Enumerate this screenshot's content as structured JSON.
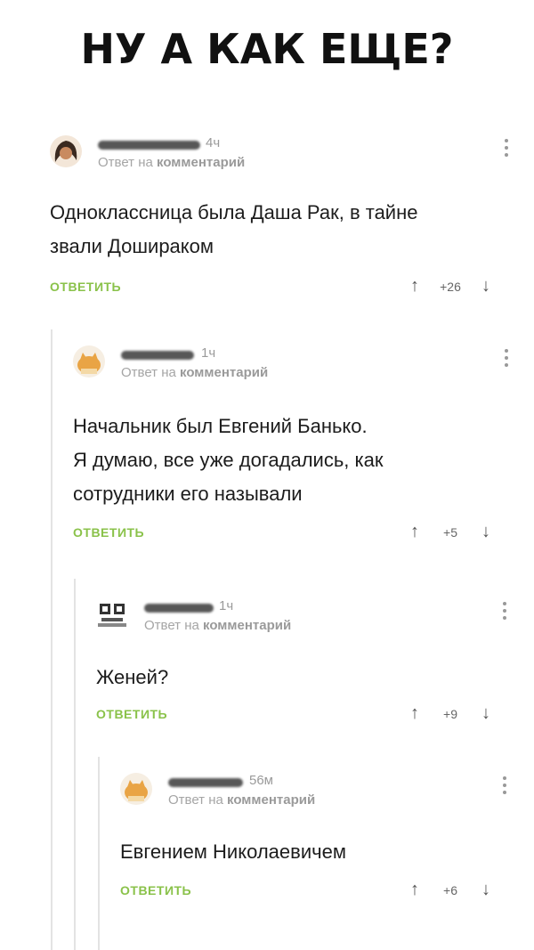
{
  "meme_title": "НУ А КАК ЕЩЕ?",
  "reply_label_prefix": "Ответ на",
  "reply_label_target": "комментарий",
  "reply_button": "ОТВЕТИТЬ",
  "upvote_icon": "↑",
  "downvote_icon": "↓",
  "accent_color": "#8ac24a",
  "comments": [
    {
      "time": "4ч",
      "avatar": "woman-avatar",
      "text_lines": [
        "Одноклассница была Даша Рак, в тайне",
        "звали Дошираком"
      ],
      "score": "+26"
    },
    {
      "time": "1ч",
      "avatar": "cat-avatar",
      "text_lines": [
        "Начальник был Евгений Банько.",
        "Я думаю, все уже догадались, как",
        "сотрудники его называли"
      ],
      "score": "+5"
    },
    {
      "time": "1ч",
      "avatar": "pixel-avatar",
      "text_lines": [
        "Женей?"
      ],
      "score": "+9"
    },
    {
      "time": "56м",
      "avatar": "cat-avatar",
      "text_lines": [
        "Евгением Николаевичем"
      ],
      "score": "+6"
    }
  ]
}
